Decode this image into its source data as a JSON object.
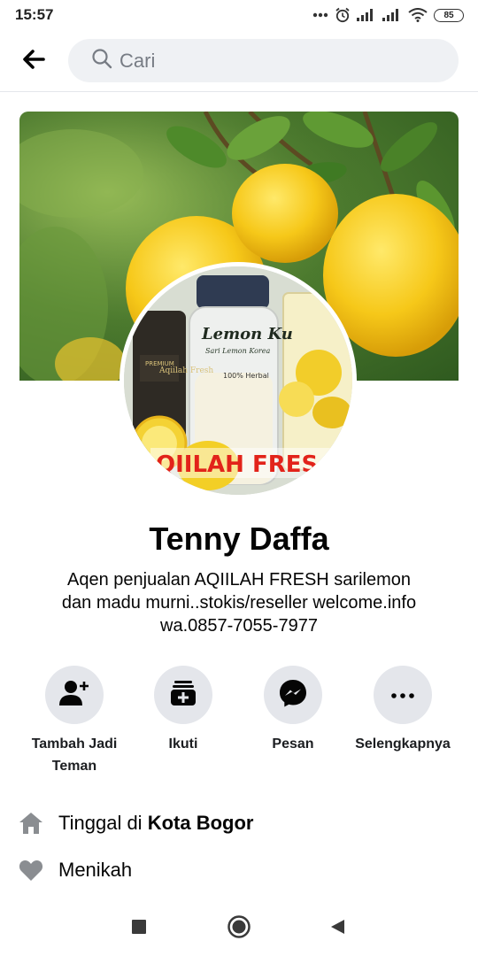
{
  "status_bar": {
    "time": "15:57",
    "battery": "85"
  },
  "search": {
    "placeholder": "Cari"
  },
  "profile": {
    "name": "Tenny Daffa",
    "bio_lines": [
      "Aqen penjualan AQIILAH FRESH sarilemon",
      "dan madu murni..stokis/reseller welcome.info",
      "wa.0857-7055-7977"
    ],
    "avatar_text": {
      "product_title": "Lemon Ku",
      "product_subtitle": "Sari Lemon Korea",
      "herbal": "100% Herbal",
      "bottle_brand": "Aqiilah Fresh",
      "bottle_label": "PREMIUM",
      "banner": "QIILAH FRES"
    }
  },
  "actions": [
    {
      "label_line1": "Tambah Jadi",
      "label_line2": "Teman",
      "icon": "add-friend-icon"
    },
    {
      "label_line1": "Ikuti",
      "label_line2": "",
      "icon": "follow-icon"
    },
    {
      "label_line1": "Pesan",
      "label_line2": "",
      "icon": "messenger-icon"
    },
    {
      "label_line1": "Selengkapnya",
      "label_line2": "",
      "icon": "more-icon"
    }
  ],
  "info": {
    "lives_prefix": "Tinggal di ",
    "lives_city": "Kota Bogor",
    "relationship": "Menikah"
  },
  "colors": {
    "accent": "#1877f2",
    "action_bg": "#e4e6eb",
    "search_bg": "#eff1f4"
  }
}
